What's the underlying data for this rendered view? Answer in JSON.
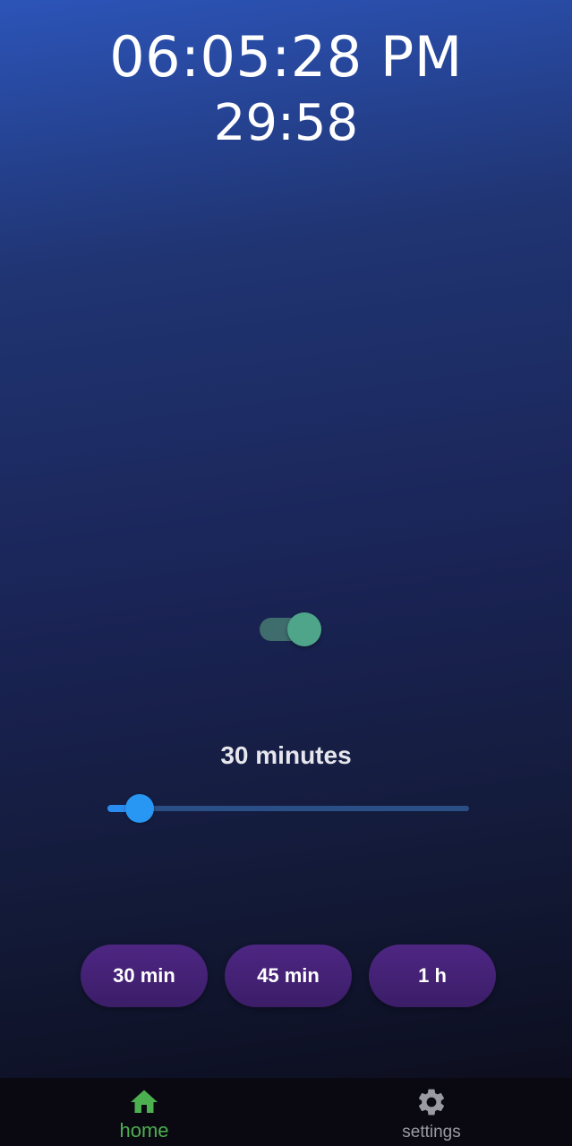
{
  "header": {
    "clock": "06:05:28 PM",
    "countdown": "29:58"
  },
  "timer_toggle": {
    "state": "on",
    "track_color": "#3f6c6c",
    "thumb_color": "#4ea58a"
  },
  "duration": {
    "label": "30 minutes",
    "slider_fraction": 0.09,
    "fill_color": "#2a8cf0",
    "track_color": "#2a4f86"
  },
  "presets": [
    {
      "label": "30 min"
    },
    {
      "label": "45 min"
    },
    {
      "label": "1 h"
    }
  ],
  "preset_color": "#4a247c",
  "bottom_nav": {
    "items": [
      {
        "label": "home",
        "icon": "home-icon",
        "active": true,
        "color": "#4caf50"
      },
      {
        "label": "settings",
        "icon": "gear-icon",
        "active": false,
        "color": "#9a9aa2"
      }
    ]
  }
}
